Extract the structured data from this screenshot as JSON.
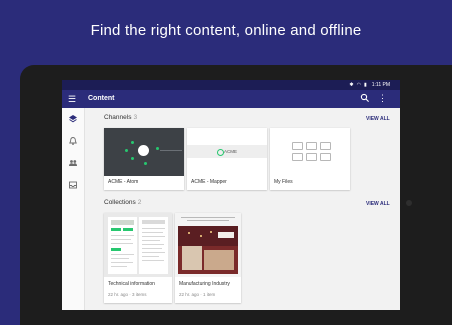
{
  "headline": "Find the right content, online and offline",
  "status_bar": {
    "time": "1:11 PM"
  },
  "app_bar": {
    "title": "Content",
    "menu_icon": "hamburger-menu-icon",
    "search_icon": "search-icon",
    "more_icon": "more-vert-icon"
  },
  "nav_rail": [
    {
      "icon": "layers-icon",
      "active": true
    },
    {
      "icon": "bell-icon",
      "active": false
    },
    {
      "icon": "people-icon",
      "active": false
    },
    {
      "icon": "inbox-icon",
      "active": false
    }
  ],
  "channels": {
    "title": "Channels",
    "count": "3",
    "view_all": "VIEW ALL",
    "items": [
      {
        "label": "ACME - Atom"
      },
      {
        "label": "ACME - Mapper",
        "logo_text": "ACME"
      },
      {
        "label": "My Files"
      }
    ]
  },
  "collections": {
    "title": "Collections",
    "count": "2",
    "view_all": "VIEW ALL",
    "items": [
      {
        "label": "Technical information",
        "meta": "22 hr. ago · 3 items"
      },
      {
        "label": "Manufacturing Industry",
        "meta": "22 hr. ago · 1 item"
      }
    ]
  },
  "colors": {
    "brand": "#2b2c7a",
    "status_bar": "#1c1d55",
    "accent_green": "#27c76f",
    "background": "#f2f2f2"
  }
}
